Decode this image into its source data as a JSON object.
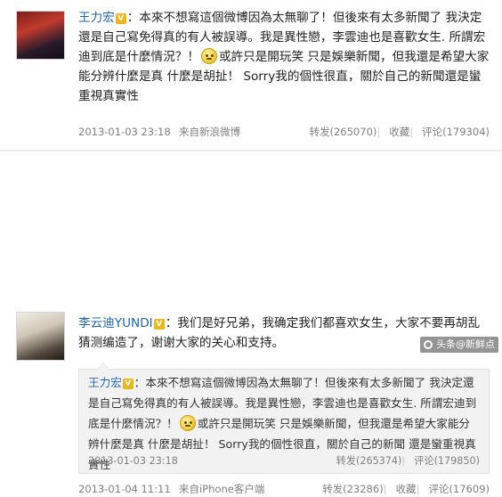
{
  "post1": {
    "author": "王力宏",
    "verified_badge": "V",
    "text_before_emoji": "：本來不想寫這個微博因為太無聊了！但後來有太多新聞了 我決定還是自己寫免得真的有人被誤導。我是異性戀，李雲迪也是喜歡女生. 所謂宏迪到底是什麼情況？！",
    "emoji_icon": "smile-emoji-icon",
    "text_after_emoji": "或許只是開玩笑 只是娛樂新聞，但我還是希望大家能分辨什麼是真 什麼是胡扯！ Sorry我的個性很直，關於自己的新聞還是蠻重視真實性",
    "date": "2013-01-03 23:18",
    "source": "来自新浪微博",
    "repost_label": "转发(265070)",
    "favorite_label": "收藏",
    "comment_label": "评论(179304)"
  },
  "post2": {
    "author": "李云迪YUNDI",
    "verified_badge": "V",
    "text": "：我们是好兄弟，我确定我们都喜欢女生，大家不要再胡乱猜测编造了，谢谢大家的关心和支持。",
    "repost": {
      "author": "王力宏",
      "verified_badge": "V",
      "text_before_emoji": "：本來不想寫這個微博因為太無聊了！但後來有太多新聞了 我決定還是自己寫免得真的有人被誤導。我是異性戀，李雲迪也是喜歡女生. 所謂宏迪到底是什麼情況？！",
      "emoji_icon": "smile-emoji-icon",
      "text_after_emoji": "或許只是開玩笑 只是娛樂新聞，但我還是希望大家能分辨什麼是真 什麼是胡扯！ Sorry我的個性很直，關於自己的新聞 還是蠻重視真實性",
      "date": "2013-01-03 23:18",
      "repost_label": "转发(265374)",
      "comment_label": "评论(179850)"
    },
    "date": "2013-01-04 11:11",
    "source": "来自iPhone客户端",
    "repost_label": "转发(23286)",
    "favorite_label": "收藏",
    "comment_label": "评论(17609)"
  },
  "watermark": {
    "text": "头条@新鲜点",
    "icon": "watermark-logo-icon"
  }
}
